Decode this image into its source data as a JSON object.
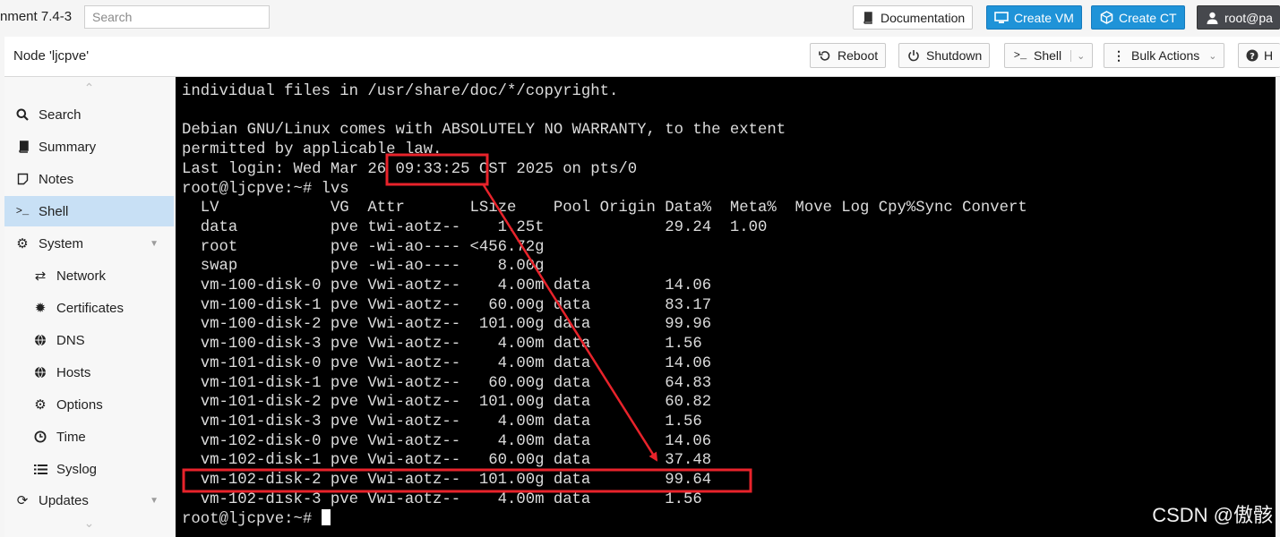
{
  "topbar": {
    "app_title": "nment 7.4-3",
    "search_placeholder": "Search",
    "documentation_label": "Documentation",
    "create_vm_label": "Create VM",
    "create_ct_label": "Create CT",
    "user_label": "root@pa"
  },
  "node_header": {
    "title": "Node 'ljcpve'",
    "reboot_label": "Reboot",
    "shutdown_label": "Shutdown",
    "shell_label": "Shell",
    "bulk_actions_label": "Bulk Actions",
    "help_label": "H"
  },
  "sidebar": {
    "items": [
      {
        "label": "Search",
        "icon": "search-icon",
        "level": 1
      },
      {
        "label": "Summary",
        "icon": "book-icon",
        "level": 1
      },
      {
        "label": "Notes",
        "icon": "note-icon",
        "level": 1
      },
      {
        "label": "Shell",
        "icon": "terminal-icon",
        "level": 1,
        "active": true
      },
      {
        "label": "System",
        "icon": "gears-icon",
        "level": 1,
        "expandable": true
      },
      {
        "label": "Network",
        "icon": "exchange-icon",
        "level": 2
      },
      {
        "label": "Certificates",
        "icon": "certificate-icon",
        "level": 2
      },
      {
        "label": "DNS",
        "icon": "globe-icon",
        "level": 2
      },
      {
        "label": "Hosts",
        "icon": "globe-icon",
        "level": 2
      },
      {
        "label": "Options",
        "icon": "gear-icon",
        "level": 2
      },
      {
        "label": "Time",
        "icon": "clock-icon",
        "level": 2
      },
      {
        "label": "Syslog",
        "icon": "list-icon",
        "level": 2
      },
      {
        "label": "Updates",
        "icon": "refresh-icon",
        "level": 1,
        "expandable": true
      }
    ]
  },
  "terminal": {
    "lines": [
      "individual files in /usr/share/doc/*/copyright.",
      "",
      "Debian GNU/Linux comes with ABSOLUTELY NO WARRANTY, to the extent",
      "permitted by applicable law.",
      "Last login: Wed Mar 26 09:33:25 CST 2025 on pts/0",
      "root@ljcpve:~# lvs",
      "  LV            VG  Attr       LSize    Pool Origin Data%  Meta%  Move Log Cpy%Sync Convert",
      "  data          pve twi-aotz--    1.25t             29.24  1.00",
      "  root          pve -wi-ao---- <456.72g",
      "  swap          pve -wi-ao----    8.00g",
      "  vm-100-disk-0 pve Vwi-aotz--    4.00m data        14.06",
      "  vm-100-disk-1 pve Vwi-aotz--   60.00g data        83.17",
      "  vm-100-disk-2 pve Vwi-aotz--  101.00g data        99.96",
      "  vm-100-disk-3 pve Vwi-aotz--    4.00m data        1.56",
      "  vm-101-disk-0 pve Vwi-aotz--    4.00m data        14.06",
      "  vm-101-disk-1 pve Vwi-aotz--   60.00g data        64.83",
      "  vm-101-disk-2 pve Vwi-aotz--  101.00g data        60.82",
      "  vm-101-disk-3 pve Vwi-aotz--    4.00m data        1.56",
      "  vm-102-disk-0 pve Vwi-aotz--    4.00m data        14.06",
      "  vm-102-disk-1 pve Vwi-aotz--   60.00g data        37.48",
      "  vm-102-disk-2 pve Vwi-aotz--  101.00g data        99.64",
      "  vm-102-disk-3 pve Vwi-aotz--    4.00m data        1.56",
      "root@ljcpve:~# "
    ]
  },
  "annotation": {
    "color": "#e8232b",
    "csdn_watermark": "CSDN @傲骸"
  },
  "colors": {
    "accent_blue": "#1f93d8",
    "sidebar_active": "#c8e0f5",
    "terminal_bg": "#000000"
  }
}
